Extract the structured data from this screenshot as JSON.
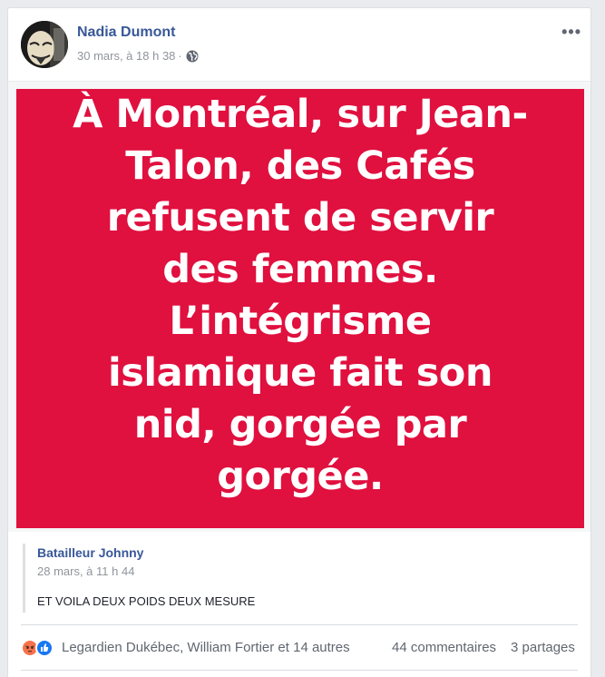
{
  "post": {
    "author": "Nadia Dumont",
    "timestamp": "30 mars, à 18 h 38",
    "separator": "·",
    "privacy_icon": "globe-icon",
    "more_icon": "more-options-icon"
  },
  "image": {
    "background_color": "#e0103f",
    "text": "À Montréal, sur Jean-Talon, des Cafés refusent de servir des femmes. L’intégrisme islamique fait son nid, gorgée par gorgée."
  },
  "shared": {
    "author": "Batailleur Johnny",
    "timestamp": "28 mars, à 11 h 44",
    "text": "ET VOILA DEUX POIDS DEUX MESURE"
  },
  "footer": {
    "reaction_icons": [
      "angry-reaction-icon",
      "like-reaction-icon"
    ],
    "reaction_names": "Legardien Dukébec, William Fortier et 14 autres",
    "comments": "44 commentaires",
    "shares": "3 partages"
  },
  "colors": {
    "link": "#385898",
    "secondary_text": "#90949c",
    "like_blue": "#1877f2",
    "angry_orange": "#f7714c"
  }
}
